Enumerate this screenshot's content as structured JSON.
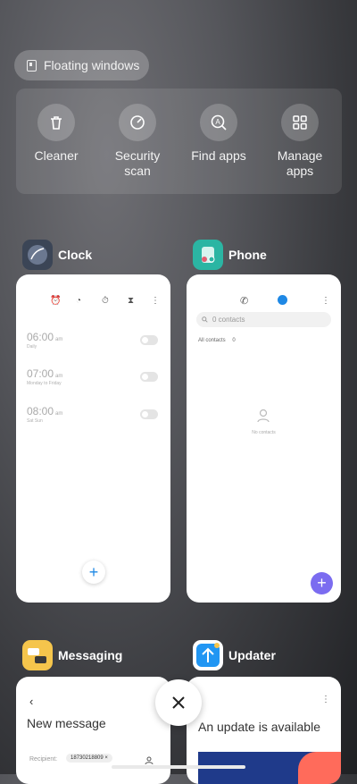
{
  "floating_windows": {
    "label": "Floating windows"
  },
  "tools": [
    {
      "label": "Cleaner",
      "icon": "trash-icon"
    },
    {
      "label": "Security\nscan",
      "icon": "security-gauge-icon"
    },
    {
      "label": "Find apps",
      "icon": "find-apps-icon"
    },
    {
      "label": "Manage\napps",
      "icon": "grid-icon"
    }
  ],
  "apps": {
    "clock": {
      "name": "Clock",
      "alarms": [
        {
          "time": "06:00",
          "ampm": "am",
          "repeat": "Daily"
        },
        {
          "time": "07:00",
          "ampm": "am",
          "repeat": "Monday to Friday"
        },
        {
          "time": "08:00",
          "ampm": "am",
          "repeat": "Sat Sun"
        }
      ],
      "fab": "+"
    },
    "phone": {
      "name": "Phone",
      "search_placeholder": "0 contacts",
      "all_contacts_label": "All contacts",
      "all_contacts_count": "0",
      "empty_label": "No contacts",
      "fab": "+"
    },
    "messaging": {
      "name": "Messaging",
      "title": "New message",
      "recipient_label": "Recipient:",
      "recipient_value": "18730218809"
    },
    "updater": {
      "name": "Updater",
      "title": "An update is available"
    }
  },
  "colors": {
    "accent_blue": "#1e88e5",
    "phone_fab": "#7b6cf0",
    "phone_icon": "#2bb5a3",
    "updater_icon": "#2196f3",
    "messaging_icon": "#f5c54c"
  }
}
